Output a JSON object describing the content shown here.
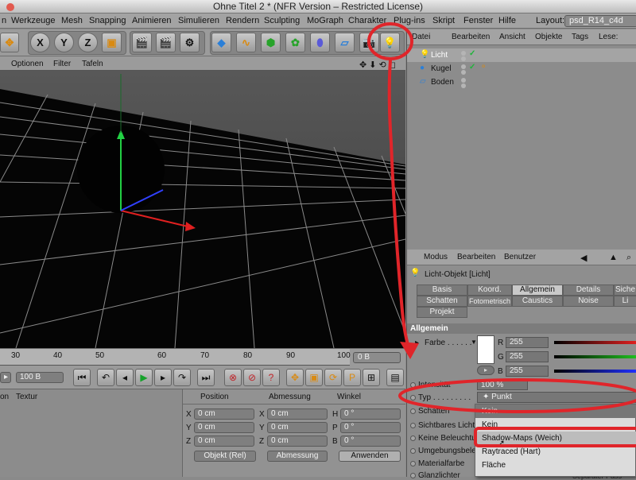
{
  "window": {
    "title": "Ohne Titel 2 * (NFR Version – Restricted License)"
  },
  "menubar": {
    "items": [
      "n",
      "Werkzeuge",
      "Mesh",
      "Snapping",
      "Animieren",
      "Simulieren",
      "Rendern",
      "Sculpting",
      "MoGraph",
      "Charakter",
      "Plug-ins",
      "Skript",
      "Fenster",
      "Hilfe"
    ],
    "layout_label": "Layout:",
    "layout_value": "psd_R14_c4d"
  },
  "toolbar": {
    "x": "X",
    "y": "Y",
    "z": "Z"
  },
  "viewport_menu": [
    "Optionen",
    "Filter",
    "Tafeln"
  ],
  "timeline": {
    "ticks": [
      "30",
      "40",
      "50",
      "60",
      "70",
      "80",
      "90",
      "100"
    ],
    "frame_field": "0 B"
  },
  "transport": {
    "end_field": "100 B"
  },
  "material": {
    "col1": "on",
    "col2": "Textur"
  },
  "coords": {
    "headers": [
      "Position",
      "Abmessung",
      "Winkel"
    ],
    "rows": [
      {
        "axis": "X",
        "pos": "0 cm",
        "size_axis": "X",
        "size": "0 cm",
        "rot_axis": "H",
        "rot": "0 °"
      },
      {
        "axis": "Y",
        "pos": "0 cm",
        "size_axis": "Y",
        "size": "0 cm",
        "rot_axis": "P",
        "rot": "0 °"
      },
      {
        "axis": "Z",
        "pos": "0 cm",
        "size_axis": "Z",
        "size": "0 cm",
        "rot_axis": "B",
        "rot": "0 °"
      }
    ],
    "mode": "Objekt (Rel)",
    "size_mode": "Abmessung",
    "apply": "Anwenden"
  },
  "object_manager": {
    "menu": [
      "Datei",
      "Bearbeiten",
      "Ansicht",
      "Objekte",
      "Tags",
      "Lese:"
    ],
    "objects": [
      "Licht",
      "Kugel",
      "Boden"
    ]
  },
  "attributes": {
    "menu": [
      "Modus",
      "Bearbeiten",
      "Benutzer"
    ],
    "object_title": "Licht-Objekt [Licht]",
    "tabs_row1": [
      "Basis",
      "Koord.",
      "Allgemein",
      "Details",
      "Siche"
    ],
    "tabs_row2": [
      "Schatten",
      "Fotometrisch",
      "Caustics",
      "Noise",
      "Li"
    ],
    "tabs_row3": [
      "Projekt"
    ],
    "active_tab": "Allgemein",
    "section": "Allgemein",
    "farbe_label": "Farbe . . . . . .",
    "rgb": [
      {
        "ch": "R",
        "val": "255"
      },
      {
        "ch": "G",
        "val": "255"
      },
      {
        "ch": "B",
        "val": "255"
      }
    ],
    "props": [
      "Intensität",
      "Typ . . . . . . . . .",
      "Schatten",
      "Sichtbares Licht",
      "Keine Beleuchtun",
      "Umgebungsbeleu",
      "Materialfarbe",
      "Glanzlichter"
    ],
    "intensity_value": "100 %",
    "type_value": "Punkt",
    "shadow_value": "Kein"
  },
  "dropdown": {
    "options": [
      "Kein",
      "Shadow-Maps (Weich)",
      "Raytraced (Hart)",
      "Fläche"
    ],
    "selected": "Shadow-Maps (Weich)"
  },
  "bottom_cut_label": "Separater Pass",
  "colors": {
    "annotation_red": "#e0252a",
    "axis_y": "#22d044",
    "axis_x": "#e02020",
    "axis_z": "#3040ff"
  }
}
